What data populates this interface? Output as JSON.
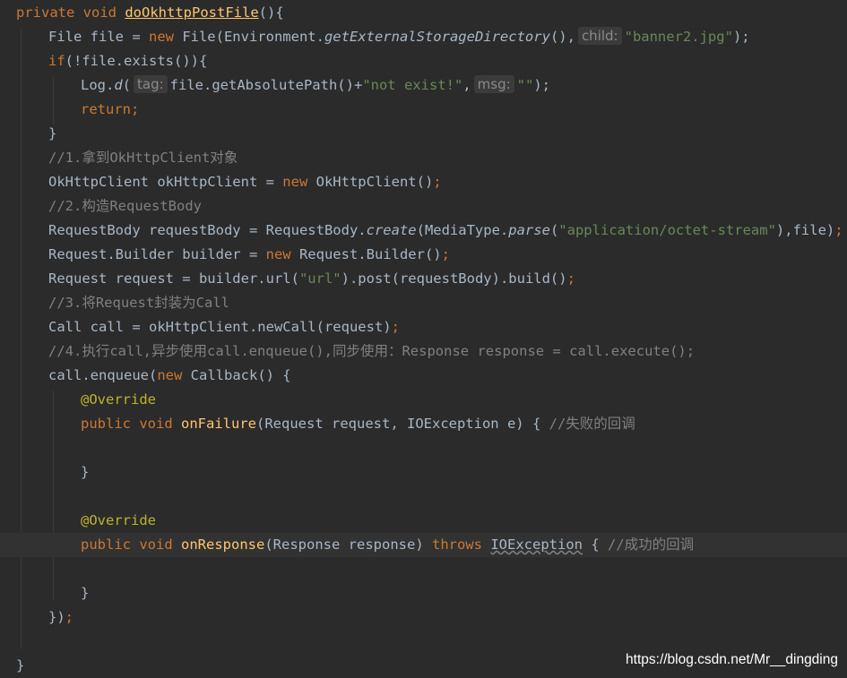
{
  "code": {
    "l1": {
      "kw_private": "private",
      "kw_void": "void",
      "method": "doOkhttpPostFile",
      "rest": "(){"
    },
    "l2": {
      "a": "File file = ",
      "kw_new": "new",
      "b": " File(Environment.",
      "c": "getExternalStorageDirectory",
      "d": "(),",
      "hint": "child:",
      "str": "\"banner2.jpg\"",
      "e": ");"
    },
    "l3": {
      "kw_if": "if",
      "a": "(!file.exists()){"
    },
    "l4": {
      "a": "Log.",
      "d": "d",
      "b": "(",
      "hint1": "tag:",
      "c": "file.getAbsolutePath()+",
      "str1": "\"not exist!\"",
      "e": ",",
      "hint2": "msg:",
      "str2": "\"\"",
      "f": ");"
    },
    "l5": {
      "kw_return": "return",
      "semi": ";"
    },
    "l6": {
      "a": "}"
    },
    "l7": {
      "comment": "//1.拿到OkHttpClient对象"
    },
    "l8": {
      "a": "OkHttpClient okHttpClient = ",
      "kw_new": "new",
      "b": " OkHttpClient()",
      "semi": ";"
    },
    "l9": {
      "comment": "//2.构造RequestBody"
    },
    "l10": {
      "a": "RequestBody requestBody = RequestBody.",
      "create": "create",
      "b": "(MediaType.",
      "parse": "parse",
      "c": "(",
      "str": "\"application/octet-stream\"",
      "d": "),file)",
      "semi": ";"
    },
    "l11": {
      "a": "Request.Builder builder = ",
      "kw_new": "new",
      "b": " Request.Builder()",
      "semi": ";"
    },
    "l12": {
      "a": "Request request = builder.url(",
      "str": "\"url\"",
      "b": ").post(requestBody).build()",
      "semi": ";"
    },
    "l13": {
      "comment": "//3.将Request封装为Call"
    },
    "l14": {
      "a": "Call call = okHttpClient.newCall(request)",
      "semi": ";"
    },
    "l15": {
      "comment": "//4.执行call,异步使用call.enqueue(),同步使用：Response response = call.execute();"
    },
    "l16": {
      "a": "call.enqueue(",
      "kw_new": "new",
      "b": " Callback() {"
    },
    "l17": {
      "annotation": "@Override"
    },
    "l18": {
      "kw_public": "public",
      "kw_void": "void",
      "method": "onFailure",
      "a": "(Request request, IOException e) {",
      "comment": "//失败的回调"
    },
    "l20": {
      "a": "}"
    },
    "l22": {
      "annotation": "@Override"
    },
    "l23": {
      "kw_public": "public",
      "kw_void": "void",
      "method": "onResponse",
      "a": "(Response response) ",
      "kw_throws": "throws",
      "exc": "IOException",
      "b": " {",
      "comment": "//成功的回调"
    },
    "l25": {
      "a": "}"
    },
    "l26": {
      "a": "})",
      "semi": ";"
    },
    "l28": {
      "a": "}"
    }
  },
  "watermark": "https://blog.csdn.net/Mr__dingding",
  "colors": {
    "background": "#2b2b2b",
    "current_line": "#323232",
    "default_text": "#a9b7c6",
    "keyword": "#cc7832",
    "method_declaration": "#ffc66d",
    "string": "#6a8759",
    "comment": "#808080",
    "annotation": "#bbb529"
  }
}
